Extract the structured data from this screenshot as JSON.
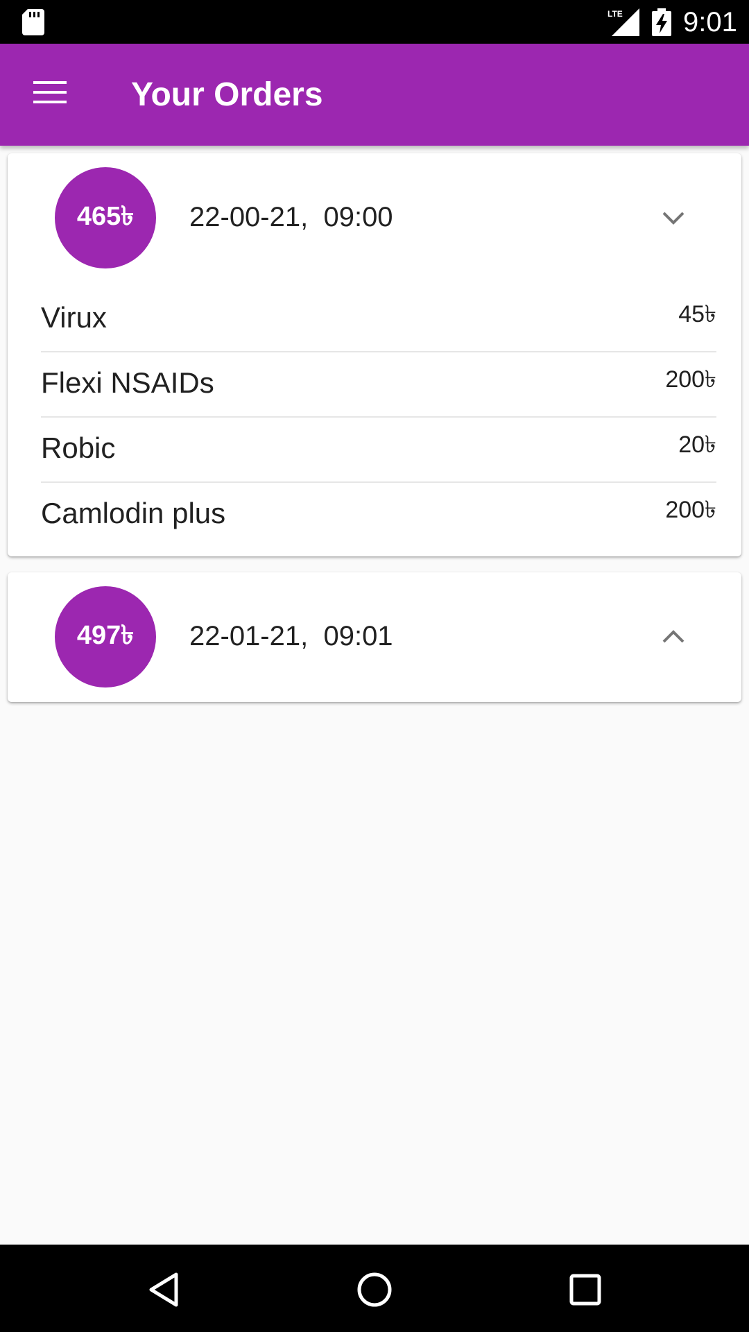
{
  "status_bar": {
    "time": "9:01",
    "network_label": "LTE",
    "icons": [
      "sd-card-icon",
      "lte-signal-icon",
      "battery-charging-icon"
    ]
  },
  "app_bar": {
    "title": "Your Orders",
    "menu_icon": "hamburger-menu-icon",
    "color": "#9c27b0"
  },
  "orders": [
    {
      "total": "465৳",
      "date": "22-00-21,  09:00",
      "toggle_icon": "chevron-down-icon",
      "items": [
        {
          "name": "Virux",
          "price": "45৳"
        },
        {
          "name": "Flexi NSAIDs",
          "price": "200৳"
        },
        {
          "name": "Robic",
          "price": "20৳"
        },
        {
          "name": "Camlodin plus",
          "price": "200৳"
        }
      ]
    },
    {
      "total": "497৳",
      "date": "22-01-21,  09:01",
      "toggle_icon": "chevron-up-icon",
      "items": []
    }
  ],
  "nav_bar": {
    "icons": [
      "back-icon",
      "home-icon",
      "recents-icon"
    ]
  }
}
